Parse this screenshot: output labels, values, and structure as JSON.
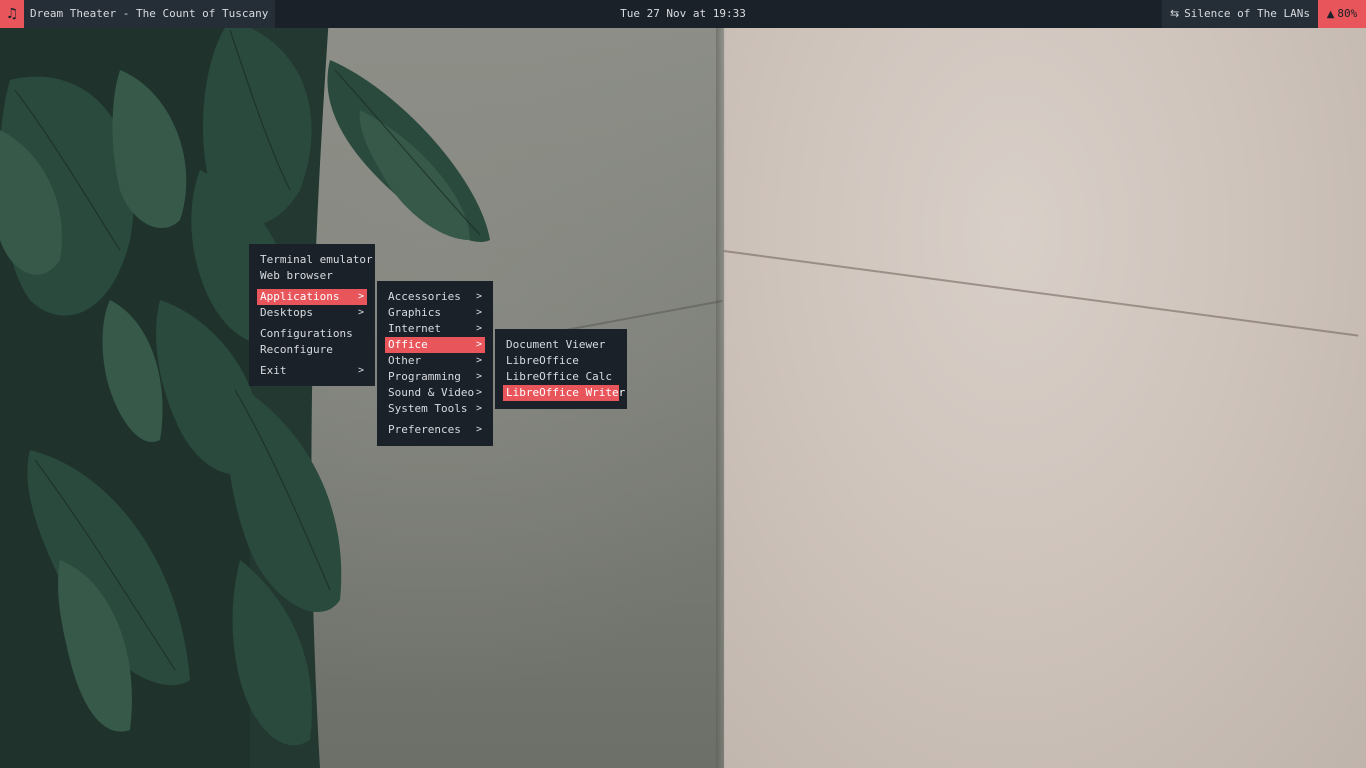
{
  "topbar": {
    "music_icon": "music-note-icon",
    "now_playing": "Dream Theater - The Count of Tuscany",
    "clock": "Tue 27 Nov at 19:33",
    "network_icon": "network-transfer-icon",
    "network_name": "Silence of The LANs",
    "battery_icon": "bell-icon",
    "battery": "80%"
  },
  "colors": {
    "bar": "#1a2129",
    "accent": "#e8555b",
    "text": "#d8dbdf"
  },
  "menus": {
    "root": {
      "items": [
        {
          "label": "Terminal emulator"
        },
        {
          "label": "Web browser"
        },
        {
          "label": "Applications",
          "arrow": ">"
        },
        {
          "label": "Desktops",
          "arrow": ">"
        },
        {
          "label": "Configurations"
        },
        {
          "label": "Reconfigure"
        },
        {
          "label": "Exit",
          "arrow": ">"
        }
      ]
    },
    "applications": {
      "items": [
        {
          "label": "Accessories",
          "arrow": ">"
        },
        {
          "label": "Graphics",
          "arrow": ">"
        },
        {
          "label": "Internet",
          "arrow": ">"
        },
        {
          "label": "Office",
          "arrow": ">"
        },
        {
          "label": "Other",
          "arrow": ">"
        },
        {
          "label": "Programming",
          "arrow": ">"
        },
        {
          "label": "Sound & Video",
          "arrow": ">"
        },
        {
          "label": "System Tools",
          "arrow": ">"
        },
        {
          "label": "Preferences",
          "arrow": ">"
        }
      ]
    },
    "office": {
      "items": [
        {
          "label": "Document Viewer"
        },
        {
          "label": "LibreOffice"
        },
        {
          "label": "LibreOffice Calc"
        },
        {
          "label": "LibreOffice Writer"
        }
      ]
    }
  }
}
